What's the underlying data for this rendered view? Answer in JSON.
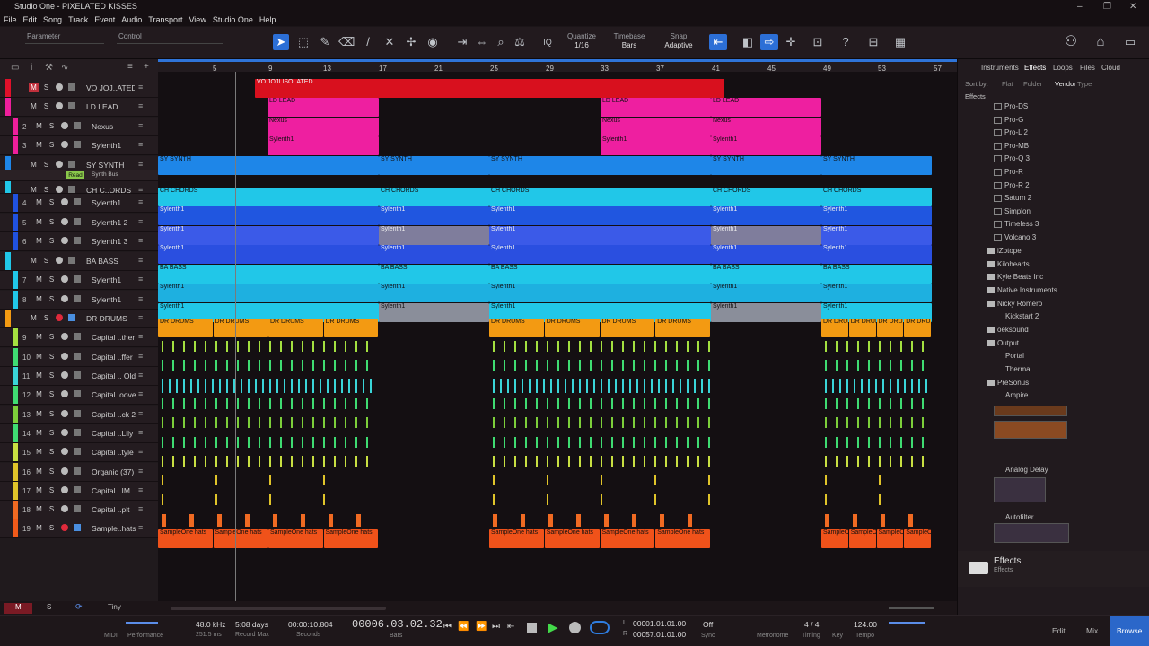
{
  "window": {
    "title": "Studio One - PIXELATED KISSES"
  },
  "menu": [
    "File",
    "Edit",
    "Song",
    "Track",
    "Event",
    "Audio",
    "Transport",
    "View",
    "Studio One",
    "Help"
  ],
  "toolbar": {
    "parameter_label": "Parameter",
    "control_label": "Control",
    "quantize_label": "Quantize",
    "quantize_value": "1/16",
    "timebase_label": "Timebase",
    "timebase_value": "Bars",
    "snap_label": "Snap",
    "snap_value": "Adaptive"
  },
  "ruler": [
    "5",
    "9",
    "13",
    "17",
    "21",
    "25",
    "29",
    "33",
    "37",
    "41",
    "45",
    "49",
    "53",
    "57"
  ],
  "tracks": [
    {
      "num": "",
      "name": "VO JOJ..ATED",
      "color": "#e0102a"
    },
    {
      "num": "",
      "name": "LD LEAD",
      "color": "#ee1f9c"
    },
    {
      "num": "2",
      "name": "Nexus",
      "color": "#ee1f9c"
    },
    {
      "num": "3",
      "name": "Sylenth1",
      "color": "#ee1f9c"
    },
    {
      "num": "",
      "name": "SY SYNTH",
      "color": "#1e86e8"
    },
    {
      "num": "",
      "name": "CH C..ORDS",
      "color": "#21c7e8",
      "extra": "Read",
      "extra2": "Synth Bus"
    },
    {
      "num": "4",
      "name": "Sylenth1",
      "color": "#2052e0"
    },
    {
      "num": "5",
      "name": "Sylenth1 2",
      "color": "#2052e0"
    },
    {
      "num": "6",
      "name": "Sylenth1 3",
      "color": "#2052e0"
    },
    {
      "num": "",
      "name": "BA BASS",
      "color": "#21c7e8"
    },
    {
      "num": "7",
      "name": "Sylenth1",
      "color": "#21c7e8"
    },
    {
      "num": "8",
      "name": "Sylenth1",
      "color": "#21c7e8"
    },
    {
      "num": "",
      "name": "DR DRUMS",
      "color": "#f39a12"
    },
    {
      "num": "9",
      "name": "Capital ..ther",
      "color": "#a4e040"
    },
    {
      "num": "10",
      "name": "Capital ..ffer",
      "color": "#3fdc72"
    },
    {
      "num": "11",
      "name": "Capital .. Old",
      "color": "#3ad5d8"
    },
    {
      "num": "12",
      "name": "Capital..oove",
      "color": "#3fdc72"
    },
    {
      "num": "13",
      "name": "Capital ..ck 2",
      "color": "#7dcf3a"
    },
    {
      "num": "14",
      "name": "Capital ..Lily",
      "color": "#3fdc72"
    },
    {
      "num": "15",
      "name": "Capital ..tyle",
      "color": "#c8e042"
    },
    {
      "num": "16",
      "name": "Organic (37)",
      "color": "#e0c42a"
    },
    {
      "num": "17",
      "name": "Capital ..IM",
      "color": "#e0c42a"
    },
    {
      "num": "18",
      "name": "Capital ..plt",
      "color": "#f06a22"
    },
    {
      "num": "19",
      "name": "Sample..hats",
      "color": "#f05a1a"
    }
  ],
  "clips": {
    "vo": "VO JOJI ISOLATED",
    "ld": "LD LEAD",
    "nexus": "Nexus",
    "syl": "Sylenth1",
    "sy": "SY SYNTH",
    "ch": "CH CHORDS",
    "ba": "BA BASS",
    "dr": "DR DRUMS",
    "hats": "SampleOne hats"
  },
  "browser": {
    "tabs": [
      "Instruments",
      "Effects",
      "Loops",
      "Files",
      "Cloud"
    ],
    "sort_label": "Sort by:",
    "sort_opts": [
      "Flat",
      "Folder",
      "Vendor",
      "Type"
    ],
    "crumb": "Effects",
    "items": [
      "Pro-DS",
      "Pro-G",
      "Pro-L 2",
      "Pro-MB",
      "Pro-Q 3",
      "Pro-R",
      "Pro-R 2",
      "Saturn 2",
      "Simplon",
      "Timeless 3",
      "Volcano 3"
    ],
    "folders": [
      "iZotope",
      "Kilohearts",
      "Kyle Beats Inc",
      "Native Instruments",
      "Nicky Romero",
      "oeksound",
      "Output",
      "PreSonus"
    ],
    "sub_nicky": "Kickstart 2",
    "sub_output": [
      "Portal",
      "Thermal"
    ],
    "presonus": [
      "Ampire",
      "Analog Delay",
      "Autofilter"
    ],
    "footer_title": "Effects",
    "footer_sub": "Effects"
  },
  "transport": {
    "midi": "MIDI",
    "performance": "Performance",
    "samplerate": "48.0 kHz",
    "latency": "251.5 ms",
    "days": "5:08 days",
    "recmax": "Record Max",
    "seconds_val": "00:00:10.804",
    "seconds_label": "Seconds",
    "bars_val": "00006.03.02.32",
    "bars_label": "Bars",
    "l_pos": "00001.01.01.00",
    "r_pos": "00057.01.01.00",
    "off": "Off",
    "sync": "Sync",
    "metronome": "Metronome",
    "timing": "Timing",
    "sig": "4 / 4",
    "key": "Key",
    "tempo_val": "124.00",
    "tempo": "Tempo",
    "edit": "Edit",
    "mix": "Mix",
    "browse": "Browse",
    "tiny": "Tiny"
  }
}
